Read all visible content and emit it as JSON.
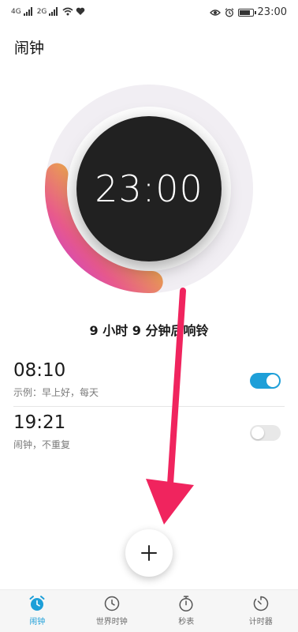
{
  "status_bar": {
    "network_1": "4G",
    "network_2": "2G",
    "time": "23:00"
  },
  "page_title": "闹钟",
  "dial": {
    "time": "23:00",
    "progress_fraction": 0.28
  },
  "ring_message": "9 小时 9 分钟后响铃",
  "alarms": [
    {
      "time": "08:10",
      "subtitle": "示例：早上好，每天",
      "enabled": true
    },
    {
      "time": "19:21",
      "subtitle": "闹钟，不重复",
      "enabled": false
    }
  ],
  "fab": {
    "icon": "plus-icon"
  },
  "tabs": [
    {
      "label": "闹钟",
      "icon": "alarm-clock-icon",
      "active": true
    },
    {
      "label": "世界时钟",
      "icon": "clock-icon",
      "active": false
    },
    {
      "label": "秒表",
      "icon": "stopwatch-icon",
      "active": false
    },
    {
      "label": "计时器",
      "icon": "timer-icon",
      "active": false
    }
  ],
  "colors": {
    "accent": "#1e9fd8",
    "arrow": "#f0245e",
    "dial_face": "#212121"
  }
}
